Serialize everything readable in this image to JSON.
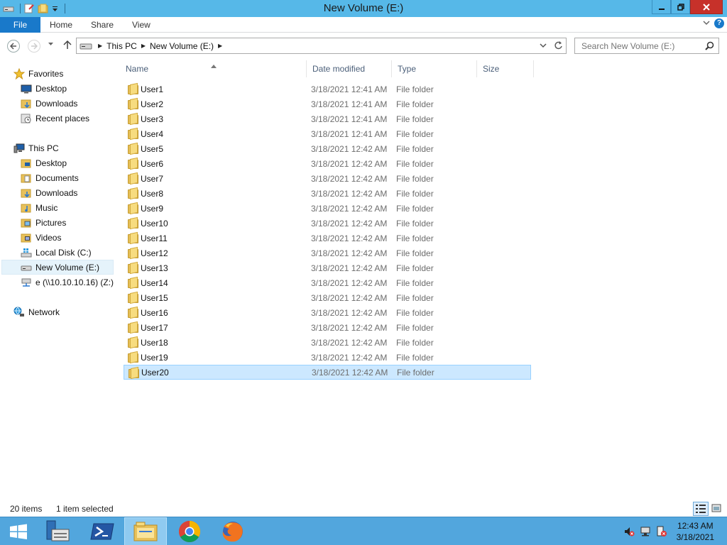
{
  "window": {
    "title": "New Volume (E:)"
  },
  "ribbon": {
    "file_tab": "File",
    "tabs": [
      "Home",
      "Share",
      "View"
    ]
  },
  "address": {
    "crumbs": [
      "This PC",
      "New Volume (E:)"
    ]
  },
  "search": {
    "placeholder": "Search New Volume (E:)"
  },
  "navpane": {
    "favorites": "Favorites",
    "favorite_items": [
      "Desktop",
      "Downloads",
      "Recent places"
    ],
    "this_pc": "This PC",
    "pc_items": [
      "Desktop",
      "Documents",
      "Downloads",
      "Music",
      "Pictures",
      "Videos",
      "Local Disk (C:)",
      "New Volume (E:)",
      "e (\\\\10.10.10.16) (Z:)"
    ],
    "network": "Network"
  },
  "columns": {
    "name": "Name",
    "date": "Date modified",
    "type": "Type",
    "size": "Size"
  },
  "files": [
    {
      "name": "User1",
      "date": "3/18/2021 12:41 AM",
      "type": "File folder"
    },
    {
      "name": "User2",
      "date": "3/18/2021 12:41 AM",
      "type": "File folder"
    },
    {
      "name": "User3",
      "date": "3/18/2021 12:41 AM",
      "type": "File folder"
    },
    {
      "name": "User4",
      "date": "3/18/2021 12:41 AM",
      "type": "File folder"
    },
    {
      "name": "User5",
      "date": "3/18/2021 12:42 AM",
      "type": "File folder"
    },
    {
      "name": "User6",
      "date": "3/18/2021 12:42 AM",
      "type": "File folder"
    },
    {
      "name": "User7",
      "date": "3/18/2021 12:42 AM",
      "type": "File folder"
    },
    {
      "name": "User8",
      "date": "3/18/2021 12:42 AM",
      "type": "File folder"
    },
    {
      "name": "User9",
      "date": "3/18/2021 12:42 AM",
      "type": "File folder"
    },
    {
      "name": "User10",
      "date": "3/18/2021 12:42 AM",
      "type": "File folder"
    },
    {
      "name": "User11",
      "date": "3/18/2021 12:42 AM",
      "type": "File folder"
    },
    {
      "name": "User12",
      "date": "3/18/2021 12:42 AM",
      "type": "File folder"
    },
    {
      "name": "User13",
      "date": "3/18/2021 12:42 AM",
      "type": "File folder"
    },
    {
      "name": "User14",
      "date": "3/18/2021 12:42 AM",
      "type": "File folder"
    },
    {
      "name": "User15",
      "date": "3/18/2021 12:42 AM",
      "type": "File folder"
    },
    {
      "name": "User16",
      "date": "3/18/2021 12:42 AM",
      "type": "File folder"
    },
    {
      "name": "User17",
      "date": "3/18/2021 12:42 AM",
      "type": "File folder"
    },
    {
      "name": "User18",
      "date": "3/18/2021 12:42 AM",
      "type": "File folder"
    },
    {
      "name": "User19",
      "date": "3/18/2021 12:42 AM",
      "type": "File folder"
    },
    {
      "name": "User20",
      "date": "3/18/2021 12:42 AM",
      "type": "File folder"
    }
  ],
  "selected_file": "User20",
  "status": {
    "items": "20 items",
    "selected": "1 item selected"
  },
  "clock": {
    "time": "12:43 AM",
    "date": "3/18/2021"
  },
  "colors": {
    "titlebar": "#56b8e8",
    "file_tab": "#1979ca",
    "selection": "#cce8ff",
    "taskbar": "#52a6dd",
    "close_button": "#c7312a"
  }
}
